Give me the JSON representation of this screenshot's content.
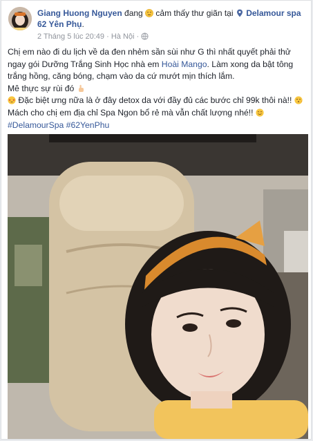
{
  "post": {
    "author": "Giang Huong Nguyen",
    "status_text": "đang",
    "feeling_text": "cảm thấy thư giãn tại",
    "place": "Delamour spa 62 Yên Phụ",
    "place_suffix": ".",
    "timestamp": "2 Tháng 5 lúc 20:49",
    "separator": "·",
    "location": "Hà Nội",
    "separator2": "·",
    "body": {
      "p1_a": "Chị em nào đi du lịch về da đen nhẻm sần sùi như G thì nhất quyết phải thử ngay gói Dưỡng Trắng Sinh Học nhà em",
      "p1_link": "Hoài Mango",
      "p1_b": ". Làm xong da bật tông trắng hồng, căng bóng, chạm vào da cứ mướt mịn thích lắm.",
      "p2": "Mê thực sự rùi đó",
      "p3": "Đặc biệt ưng nữa là ở đây detox da với đầy đủ các bước chỉ 99k thôi nà!!",
      "p4": "Mách cho chị em địa chỉ Spa Ngon bổ rẻ mà vẫn chất lượng nhé!!",
      "hashtags": "#DelamourSpa #62YenPhu"
    },
    "icons": {
      "feeling": "relieved-face-icon",
      "place": "location-pin-icon",
      "privacy": "globe-icon",
      "hand": "pointing-hand-icon",
      "star_face": "star-struck-icon",
      "kiss": "kissing-face-icon",
      "smile": "smiling-face-icon"
    },
    "colors": {
      "link": "#365899",
      "text": "#1d2129",
      "meta": "#90949c"
    }
  }
}
